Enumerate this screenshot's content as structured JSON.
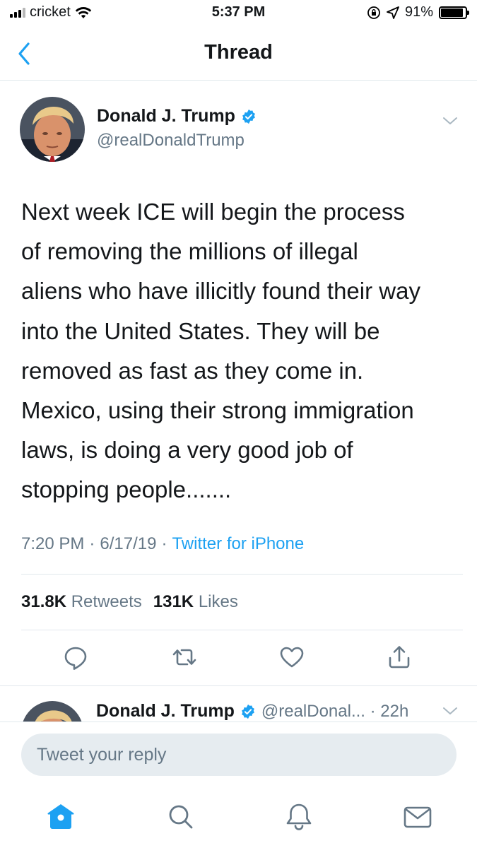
{
  "status_bar": {
    "carrier": "cricket",
    "time": "5:37 PM",
    "battery_percent": "91%",
    "battery_level": 0.91,
    "icons": [
      "signal-icon",
      "wifi-icon",
      "orientation-lock-icon",
      "location-icon",
      "battery-icon"
    ]
  },
  "nav": {
    "title": "Thread",
    "back_icon": "chevron-left-icon"
  },
  "tweet": {
    "author_name": "Donald J. Trump",
    "author_handle": "@realDonaldTrump",
    "verified": true,
    "text_lines": [
      "Next week ICE will begin the process",
      "of removing the millions of illegal",
      "aliens who have illicitly found their way",
      "into the United States. They will be",
      "removed as fast as they come in.",
      "Mexico, using their strong immigration",
      "laws, is doing a very good job of",
      "stopping people......."
    ],
    "time": "7:20 PM",
    "separator": "·",
    "date": "6/17/19",
    "source": "Twitter for iPhone",
    "retweets_count": "31.8K",
    "retweets_label": "Retweets",
    "likes_count": "131K",
    "likes_label": "Likes",
    "actions": [
      "reply-icon",
      "retweet-icon",
      "like-icon",
      "share-icon"
    ]
  },
  "next_tweet": {
    "author_name": "Donald J. Trump",
    "handle_time": "@realDonal... · 22h"
  },
  "reply": {
    "placeholder": "Tweet your reply"
  },
  "tab_bar": {
    "tabs": [
      "home-icon",
      "search-icon",
      "notifications-icon",
      "messages-icon"
    ],
    "active": "home-icon"
  },
  "colors": {
    "accent": "#1da1f2",
    "text": "#14171a",
    "secondary": "#657786",
    "divider": "#e1e8ed",
    "input_bg": "#e6ecf0"
  }
}
